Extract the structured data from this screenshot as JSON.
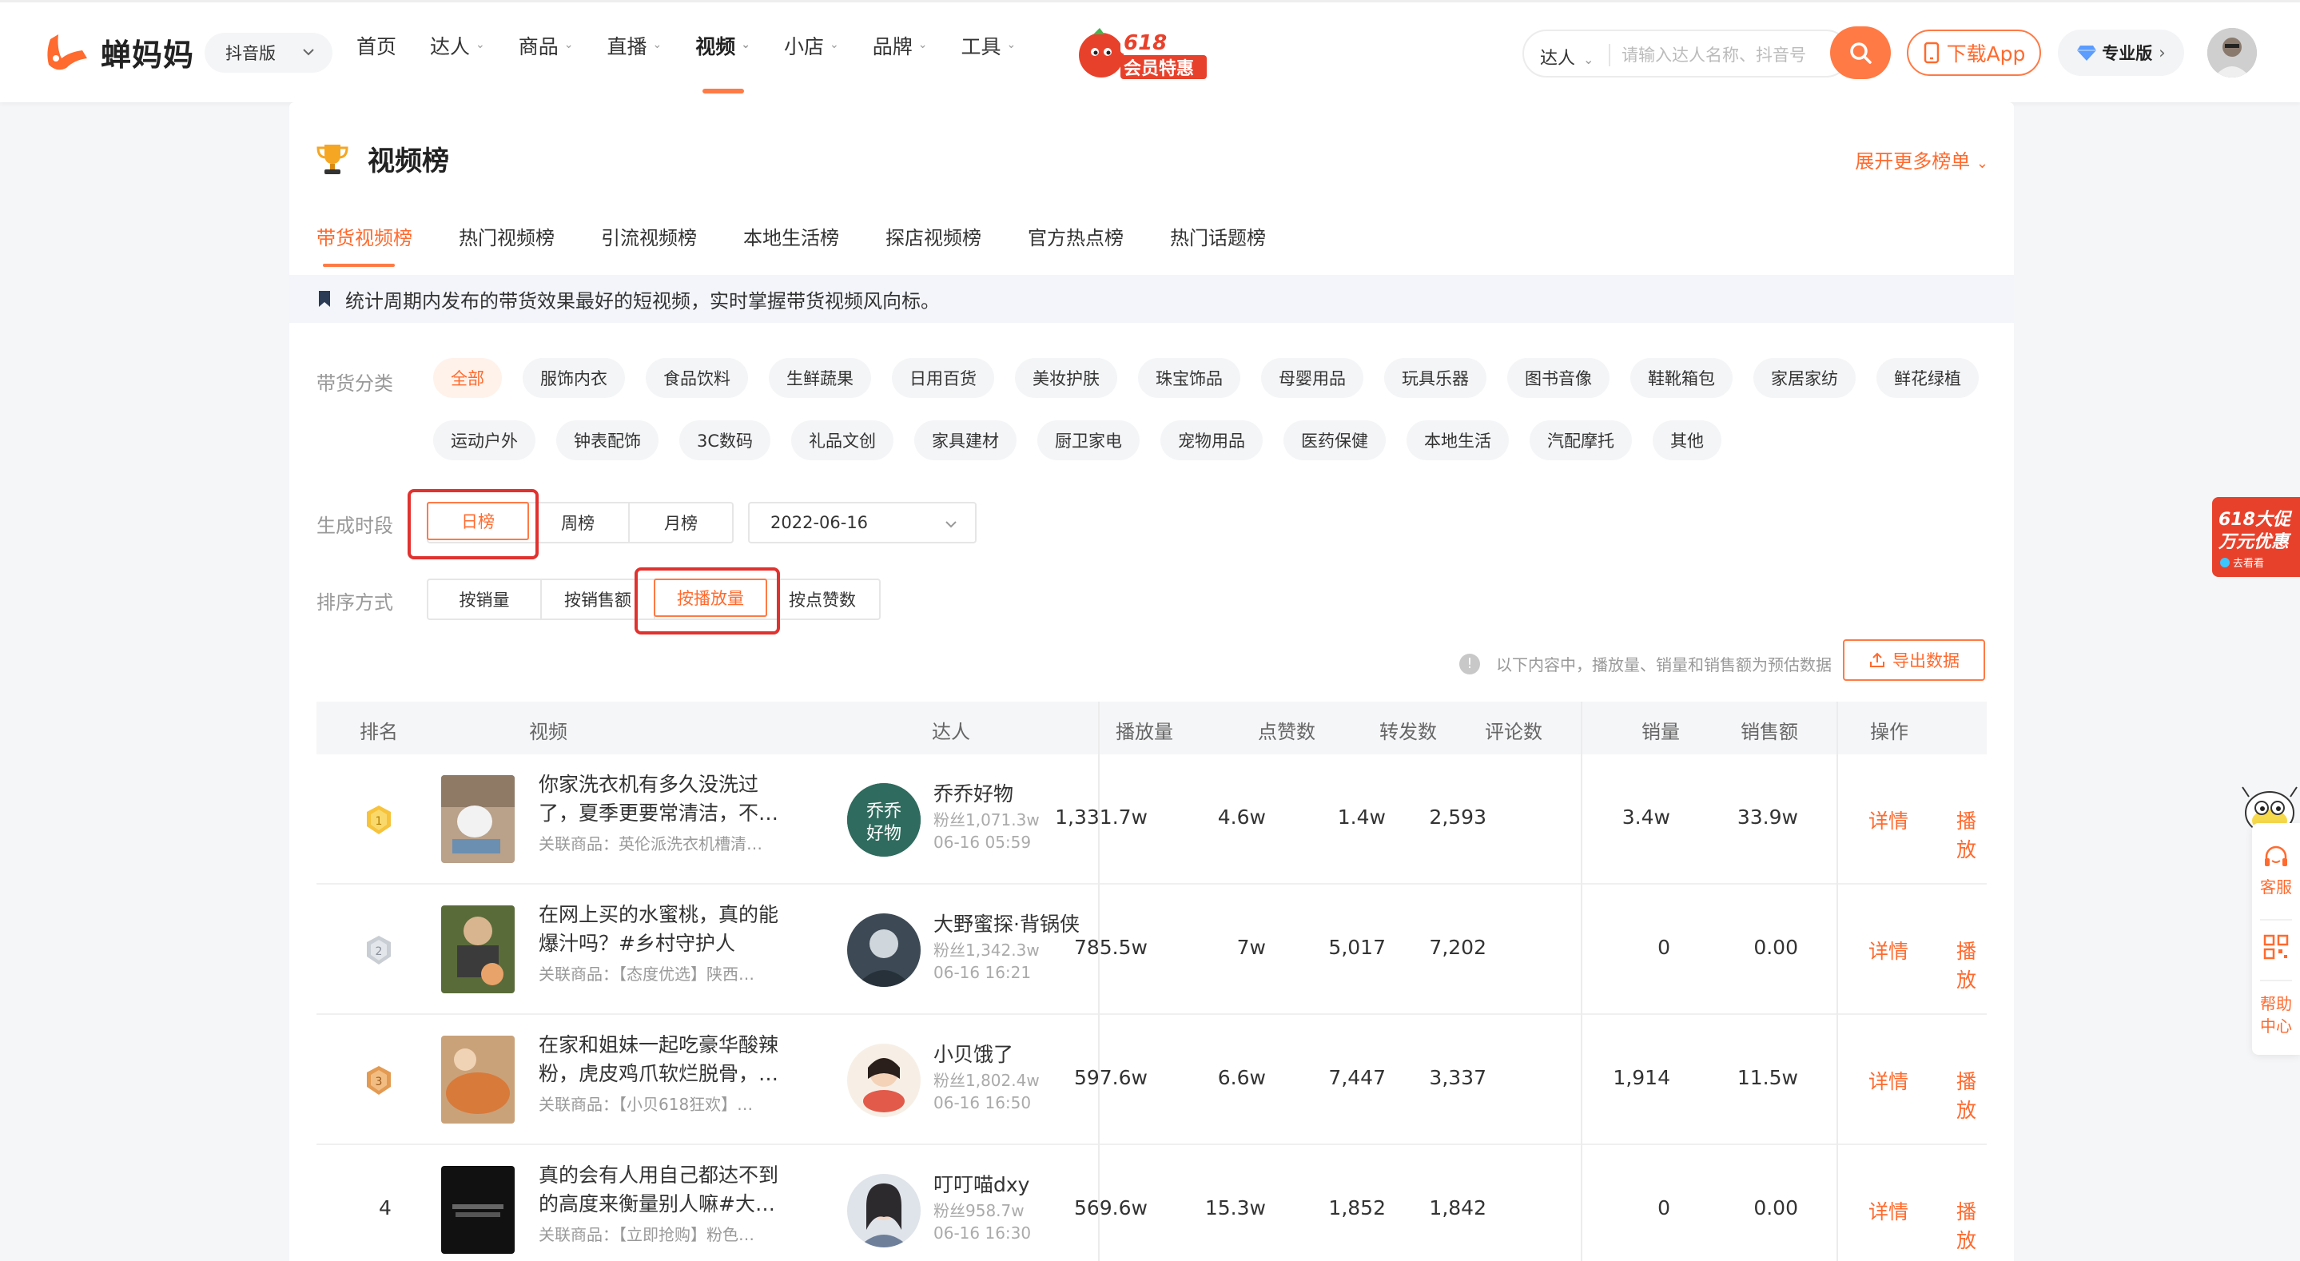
{
  "header": {
    "brand": "蝉妈妈",
    "version_select": "抖音版",
    "nav": [
      {
        "label": "首页",
        "dropdown": false,
        "active": false
      },
      {
        "label": "达人",
        "dropdown": true,
        "active": false
      },
      {
        "label": "商品",
        "dropdown": true,
        "active": false
      },
      {
        "label": "直播",
        "dropdown": true,
        "active": false
      },
      {
        "label": "视频",
        "dropdown": true,
        "active": true
      },
      {
        "label": "小店",
        "dropdown": true,
        "active": false
      },
      {
        "label": "品牌",
        "dropdown": true,
        "active": false
      },
      {
        "label": "工具",
        "dropdown": true,
        "active": false
      }
    ],
    "promo_badge_top": "618",
    "promo_badge_bottom": "会员特惠",
    "search_type": "达人",
    "search_placeholder": "请输入达人名称、抖音号",
    "download_label": "下载App",
    "pro_label": "专业版"
  },
  "page": {
    "title": "视频榜",
    "more_link": "展开更多榜单",
    "tabs": [
      "带货视频榜",
      "热门视频榜",
      "引流视频榜",
      "本地生活榜",
      "探店视频榜",
      "官方热点榜",
      "热门话题榜"
    ],
    "active_tab": 0,
    "notice": "统计周期内发布的带货效果最好的短视频，实时掌握带货视频风向标。"
  },
  "filters": {
    "category_label": "带货分类",
    "categories_row1": [
      "全部",
      "服饰内衣",
      "食品饮料",
      "生鲜蔬果",
      "日用百货",
      "美妆护肤",
      "珠宝饰品",
      "母婴用品",
      "玩具乐器",
      "图书音像",
      "鞋靴箱包",
      "家居家纺",
      "鲜花绿植"
    ],
    "categories_row2": [
      "运动户外",
      "钟表配饰",
      "3C数码",
      "礼品文创",
      "家具建材",
      "厨卫家电",
      "宠物用品",
      "医药保健",
      "本地生活",
      "汽配摩托",
      "其他"
    ],
    "period_label": "生成时段",
    "periods": [
      "日榜",
      "周榜",
      "月榜"
    ],
    "active_period": "日榜",
    "date": "2022-06-16",
    "sort_label": "排序方式",
    "sorts": [
      "按销量",
      "按销售额",
      "按播放量",
      "按点赞数"
    ],
    "active_sort": "按播放量",
    "tip": "以下内容中，播放量、销量和销售额为预估数据",
    "export_label": "导出数据"
  },
  "table": {
    "columns": [
      "排名",
      "视频",
      "达人",
      "播放量",
      "点赞数",
      "转发数",
      "评论数",
      "销量",
      "销售额",
      "操作"
    ],
    "rows": [
      {
        "rank": "1",
        "title": "你家洗衣机有多久没洗过了，夏季更要常清洁，不…",
        "goods": "关联商品：英伦派洗衣机槽清…",
        "kol": "乔乔好物",
        "fans": "粉丝1,071.3w",
        "time": "06-16 05:59",
        "plays": "1,331.7w",
        "likes": "4.6w",
        "shares": "1.4w",
        "comments": "2,593",
        "sales": "3.4w",
        "revenue": "33.9w",
        "op_detail": "详情",
        "op_play": "播放"
      },
      {
        "rank": "2",
        "title": "在网上买的水蜜桃，真的能爆汁吗？#乡村守护人",
        "goods": "关联商品：【态度优选】陕西…",
        "kol": "大野蜜探·背锅侠",
        "fans": "粉丝1,342.3w",
        "time": "06-16 16:21",
        "plays": "785.5w",
        "likes": "7w",
        "shares": "5,017",
        "comments": "7,202",
        "sales": "0",
        "revenue": "0.00",
        "op_detail": "详情",
        "op_play": "播放"
      },
      {
        "rank": "3",
        "title": "在家和姐妹一起吃豪华酸辣粉，虎皮鸡爪软烂脱骨，…",
        "goods": "关联商品：【小贝618狂欢】…",
        "kol": "小贝饿了",
        "fans": "粉丝1,802.4w",
        "time": "06-16 16:50",
        "plays": "597.6w",
        "likes": "6.6w",
        "shares": "7,447",
        "comments": "3,337",
        "sales": "1,914",
        "revenue": "11.5w",
        "op_detail": "详情",
        "op_play": "播放"
      },
      {
        "rank": "4",
        "title": "真的会有人用自己都达不到的高度来衡量别人嘛#大…",
        "goods": "关联商品：【立即抢购】粉色…",
        "kol": "叮叮喵dxy",
        "fans": "粉丝958.7w",
        "time": "06-16 16:30",
        "plays": "569.6w",
        "likes": "15.3w",
        "shares": "1,852",
        "comments": "1,842",
        "sales": "0",
        "revenue": "0.00",
        "op_detail": "详情",
        "op_play": "播放"
      }
    ]
  },
  "side": {
    "promo_l1": "618大促",
    "promo_l2": "万元优惠",
    "promo_l3": "去看看",
    "service": "客服",
    "help_l1": "帮助",
    "help_l2": "中心"
  },
  "colors": {
    "accent": "#ff7a45",
    "accent_text": "#ff6a2e",
    "highlight_box": "#e0322f"
  }
}
